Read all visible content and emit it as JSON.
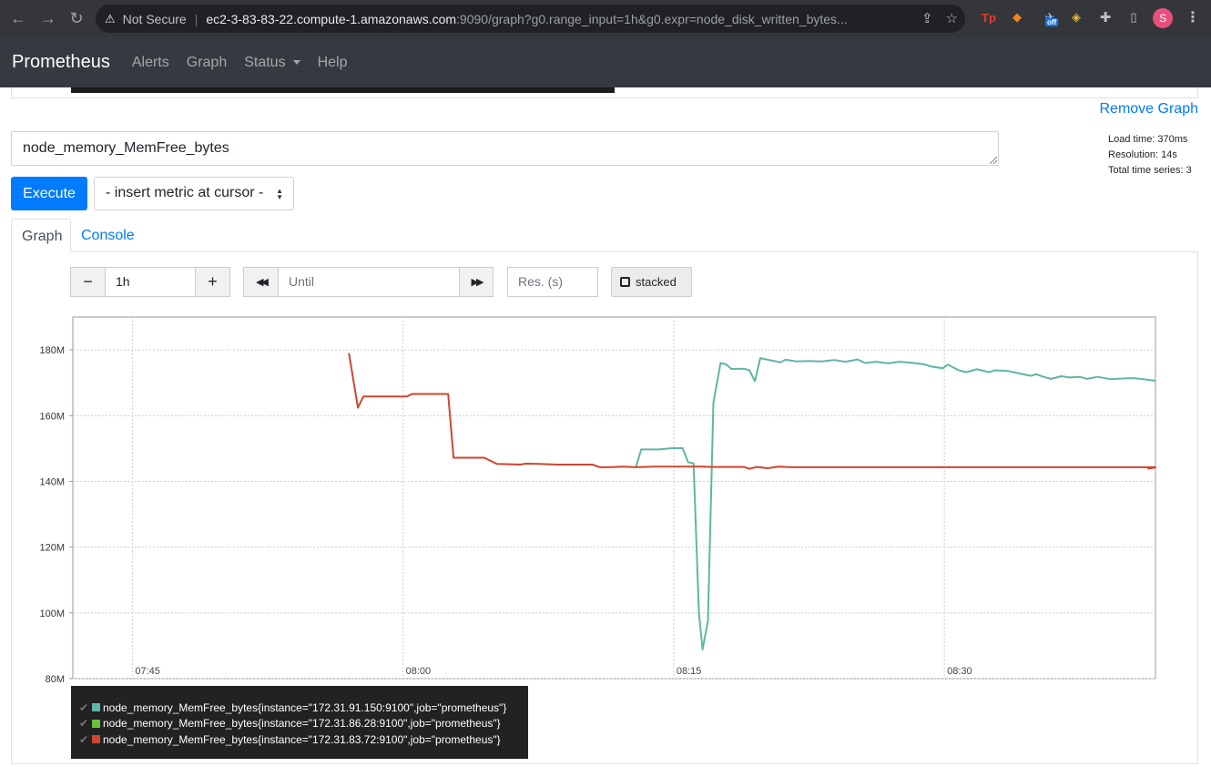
{
  "browser": {
    "security_label": "Not Secure",
    "url_host": "ec2-3-83-83-22.compute-1.amazonaws.com",
    "url_rest": ":9090/graph?g0.range_input=1h&g0.expr=node_disk_written_bytes...",
    "profile_initial": "S",
    "ext_off_badge": "off"
  },
  "navbar": {
    "brand": "Prometheus",
    "links": [
      "Alerts",
      "Graph",
      "Status",
      "Help"
    ]
  },
  "panel": {
    "remove_label": "Remove Graph",
    "expression": "node_memory_MemFree_bytes",
    "stats": {
      "load_time": "Load time: 370ms",
      "resolution": "Resolution: 14s",
      "total_series": "Total time series: 3"
    },
    "execute_label": "Execute",
    "metric_select": "- insert metric at cursor -",
    "tabs": [
      "Graph",
      "Console"
    ],
    "controls": {
      "minus": "−",
      "range": "1h",
      "plus": "+",
      "back": "◀◀",
      "until_placeholder": "Until",
      "forward": "▶▶",
      "res_placeholder": "Res. (s)",
      "stacked_label": "stacked"
    }
  },
  "chart_data": {
    "type": "line",
    "y_ticks": [
      "80M",
      "100M",
      "120M",
      "140M",
      "160M",
      "180M"
    ],
    "y_range": [
      80,
      190
    ],
    "y_unit": "M",
    "x_ticks": [
      "07:45",
      "08:00",
      "08:15",
      "08:30"
    ],
    "x_range_minutes": [
      -3.3,
      56.7
    ],
    "grid": true,
    "series": [
      {
        "name": "node_memory_MemFree_bytes{instance=\"172.31.91.150:9100\",job=\"prometheus\"}",
        "color": "#5fb6a5",
        "points": [
          [
            27.9,
            144.2
          ],
          [
            28.2,
            149.7
          ],
          [
            29.2,
            149.7
          ],
          [
            29.9,
            150.1
          ],
          [
            30.5,
            150.1
          ],
          [
            30.8,
            145.8
          ],
          [
            31.1,
            145.5
          ],
          [
            31.4,
            100
          ],
          [
            31.6,
            88.9
          ],
          [
            31.9,
            97.5
          ],
          [
            32.2,
            164
          ],
          [
            32.6,
            176
          ],
          [
            32.9,
            175.6
          ],
          [
            33.2,
            174.2
          ],
          [
            33.9,
            174.3
          ],
          [
            34.2,
            173.8
          ],
          [
            34.5,
            170.5
          ],
          [
            34.8,
            177.5
          ],
          [
            35.2,
            177
          ],
          [
            35.5,
            176.7
          ],
          [
            35.9,
            176.2
          ],
          [
            36.2,
            177
          ],
          [
            36.8,
            176.5
          ],
          [
            37.5,
            176.6
          ],
          [
            38.2,
            176.5
          ],
          [
            38.9,
            176.9
          ],
          [
            39.5,
            176.4
          ],
          [
            40.2,
            177.1
          ],
          [
            40.6,
            176
          ],
          [
            41.2,
            176.4
          ],
          [
            41.9,
            175.9
          ],
          [
            42.5,
            176.4
          ],
          [
            43.2,
            176.1
          ],
          [
            43.9,
            175.6
          ],
          [
            44.2,
            175
          ],
          [
            44.9,
            174.4
          ],
          [
            45.2,
            175.5
          ],
          [
            45.8,
            173.8
          ],
          [
            46.2,
            173.2
          ],
          [
            46.8,
            174.1
          ],
          [
            47.5,
            173.2
          ],
          [
            47.8,
            173.8
          ],
          [
            48.5,
            173.6
          ],
          [
            49.2,
            172.8
          ],
          [
            49.8,
            172.1
          ],
          [
            50.1,
            172.6
          ],
          [
            50.5,
            171.8
          ],
          [
            50.9,
            171.2
          ],
          [
            51.5,
            172
          ],
          [
            51.9,
            171.6
          ],
          [
            52.5,
            171.8
          ],
          [
            52.9,
            171.2
          ],
          [
            53.5,
            171.8
          ],
          [
            54.2,
            171.1
          ],
          [
            54.9,
            171.3
          ],
          [
            55.5,
            171.4
          ],
          [
            56.2,
            171
          ],
          [
            56.7,
            170.6
          ]
        ]
      },
      {
        "name": "node_memory_MemFree_bytes{instance=\"172.31.86.28:9100\",job=\"prometheus\"}",
        "color": "#6abf40",
        "points": []
      },
      {
        "name": "node_memory_MemFree_bytes{instance=\"172.31.83.72:9100\",job=\"prometheus\"}",
        "color": "#cd4632",
        "points": [
          [
            12,
            179
          ],
          [
            12.5,
            162.4
          ],
          [
            12.8,
            165.8
          ],
          [
            14.5,
            165.8
          ],
          [
            15.2,
            165.8
          ],
          [
            15.5,
            166.6
          ],
          [
            17.5,
            166.6
          ],
          [
            17.8,
            147.2
          ],
          [
            19.5,
            147.2
          ],
          [
            20.2,
            145.3
          ],
          [
            21.5,
            145.1
          ],
          [
            21.8,
            145.4
          ],
          [
            22.5,
            145.3
          ],
          [
            23.5,
            145.1
          ],
          [
            24.5,
            145.1
          ],
          [
            25.5,
            145.1
          ],
          [
            25.9,
            144.3
          ],
          [
            26.5,
            144.3
          ],
          [
            27.2,
            144.5
          ],
          [
            27.9,
            144.3
          ],
          [
            28.9,
            144.5
          ],
          [
            30.5,
            144.5
          ],
          [
            31.5,
            144.5
          ],
          [
            32.2,
            144.4
          ],
          [
            33.9,
            144.4
          ],
          [
            34.2,
            143.8
          ],
          [
            34.6,
            144.4
          ],
          [
            35.2,
            144
          ],
          [
            35.8,
            144.5
          ],
          [
            36.5,
            144.3
          ],
          [
            37.5,
            144.3
          ],
          [
            56.7,
            144.3
          ],
          [
            56.3,
            143.9
          ],
          [
            56.7,
            144.2
          ]
        ]
      }
    ]
  }
}
